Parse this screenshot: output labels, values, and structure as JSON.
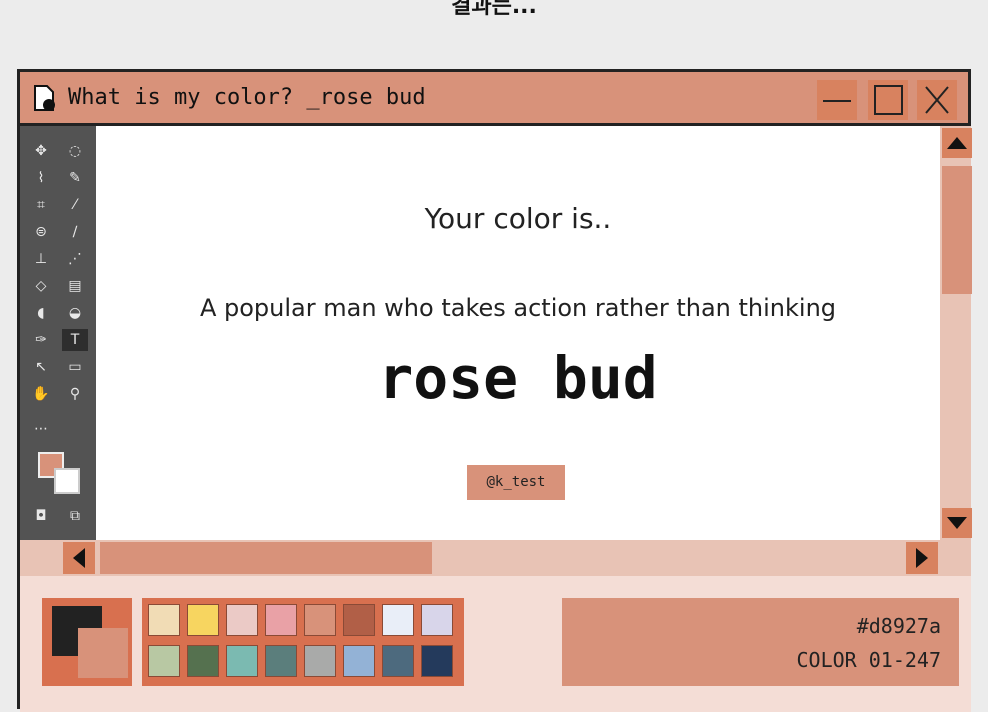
{
  "page": {
    "heading": "결과는..."
  },
  "window": {
    "title": "What is my color? _rose bud",
    "controls": {
      "minimize": "minimize",
      "maximize": "maximize",
      "close": "close"
    }
  },
  "toolbar": {
    "tools": [
      {
        "name": "move-tool-icon",
        "glyph": "✥"
      },
      {
        "name": "ellipse-marquee-tool-icon",
        "glyph": "◌"
      },
      {
        "name": "lasso-tool-icon",
        "glyph": "⌇"
      },
      {
        "name": "quick-select-tool-icon",
        "glyph": "✎"
      },
      {
        "name": "crop-tool-icon",
        "glyph": "⌗"
      },
      {
        "name": "eyedropper-tool-icon",
        "glyph": "⁄"
      },
      {
        "name": "patch-tool-icon",
        "glyph": "⊜"
      },
      {
        "name": "brush-tool-icon",
        "glyph": "∕"
      },
      {
        "name": "stamp-tool-icon",
        "glyph": "⊥"
      },
      {
        "name": "history-brush-tool-icon",
        "glyph": "⋰"
      },
      {
        "name": "eraser-tool-icon",
        "glyph": "◇"
      },
      {
        "name": "gradient-tool-icon",
        "glyph": "▤"
      },
      {
        "name": "smudge-tool-icon",
        "glyph": "◖"
      },
      {
        "name": "dodge-tool-icon",
        "glyph": "◒"
      },
      {
        "name": "pen-tool-icon",
        "glyph": "✑"
      },
      {
        "name": "type-tool-icon",
        "glyph": "T"
      },
      {
        "name": "path-select-tool-icon",
        "glyph": "↖"
      },
      {
        "name": "rectangle-tool-icon",
        "glyph": "▭"
      },
      {
        "name": "hand-tool-icon",
        "glyph": "✋"
      },
      {
        "name": "zoom-tool-icon",
        "glyph": "⚲"
      },
      {
        "name": "more-tools-icon",
        "glyph": "⋯"
      },
      {
        "name": "quick-mask-icon",
        "glyph": "◘"
      },
      {
        "name": "screen-mode-icon",
        "glyph": "⧉"
      }
    ],
    "foreground_color": "#d8927a",
    "background_color": "#ffffff"
  },
  "result": {
    "headline": "Your color is..",
    "description": "A popular man who takes action rather than thinking",
    "color_name": "rose bud",
    "credit": "@k_test"
  },
  "palette": {
    "primary": "#222222",
    "secondary": "#d8927a",
    "swatches": [
      "#f1dcb5",
      "#f7d560",
      "#ebcac6",
      "#e9a1a6",
      "#d8927a",
      "#b15f47",
      "#e9eef8",
      "#d8d5ea",
      "#b8c8a3",
      "#55714f",
      "#7bbab1",
      "#5b7e7c",
      "#a9aaa9",
      "#93b2d6",
      "#4d6a7e",
      "#243a5c"
    ]
  },
  "info": {
    "hex": "#d8927a",
    "code": "COLOR 01-247"
  },
  "theme": {
    "accent": "#d8927a",
    "accent_dark": "#d8825f",
    "surface": "#f4ddd6",
    "toolbar": "#535353"
  }
}
